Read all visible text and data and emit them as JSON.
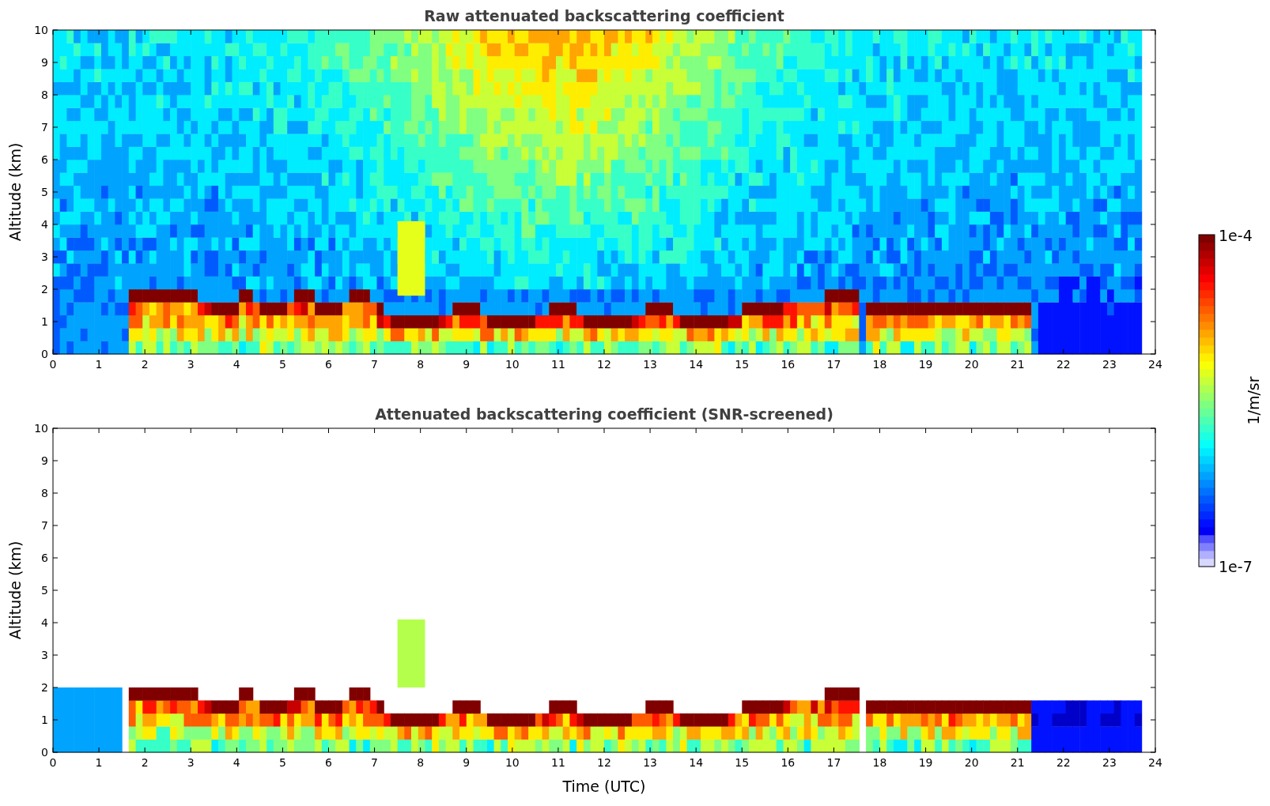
{
  "panels": [
    {
      "kind": "raw",
      "title": "Raw attenuated backscattering coefficient",
      "ylabel": "Altitude (km)",
      "xticks": [
        "0",
        "1",
        "2",
        "3",
        "4",
        "5",
        "6",
        "7",
        "8",
        "9",
        "10",
        "11",
        "12",
        "13",
        "14",
        "15",
        "16",
        "17",
        "18",
        "19",
        "20",
        "21",
        "22",
        "23",
        "24"
      ],
      "yticks": [
        "10",
        "9",
        "8",
        "7",
        "6",
        "5",
        "4",
        "3",
        "2",
        "1",
        "0"
      ]
    },
    {
      "kind": "screened",
      "title": "Attenuated backscattering coefficient (SNR-screened)",
      "ylabel": "Altitude (km)",
      "xlabel": "Time (UTC)",
      "xticks": [
        "0",
        "1",
        "2",
        "3",
        "4",
        "5",
        "6",
        "7",
        "8",
        "9",
        "10",
        "11",
        "12",
        "13",
        "14",
        "15",
        "16",
        "17",
        "18",
        "19",
        "20",
        "21",
        "22",
        "23",
        "24"
      ],
      "yticks": [
        "10",
        "9",
        "8",
        "7",
        "6",
        "5",
        "4",
        "3",
        "2",
        "1",
        "0"
      ]
    }
  ],
  "colorbar": {
    "max_label": "1e-4",
    "min_label": "1e-7",
    "label": "1/m/sr"
  }
}
